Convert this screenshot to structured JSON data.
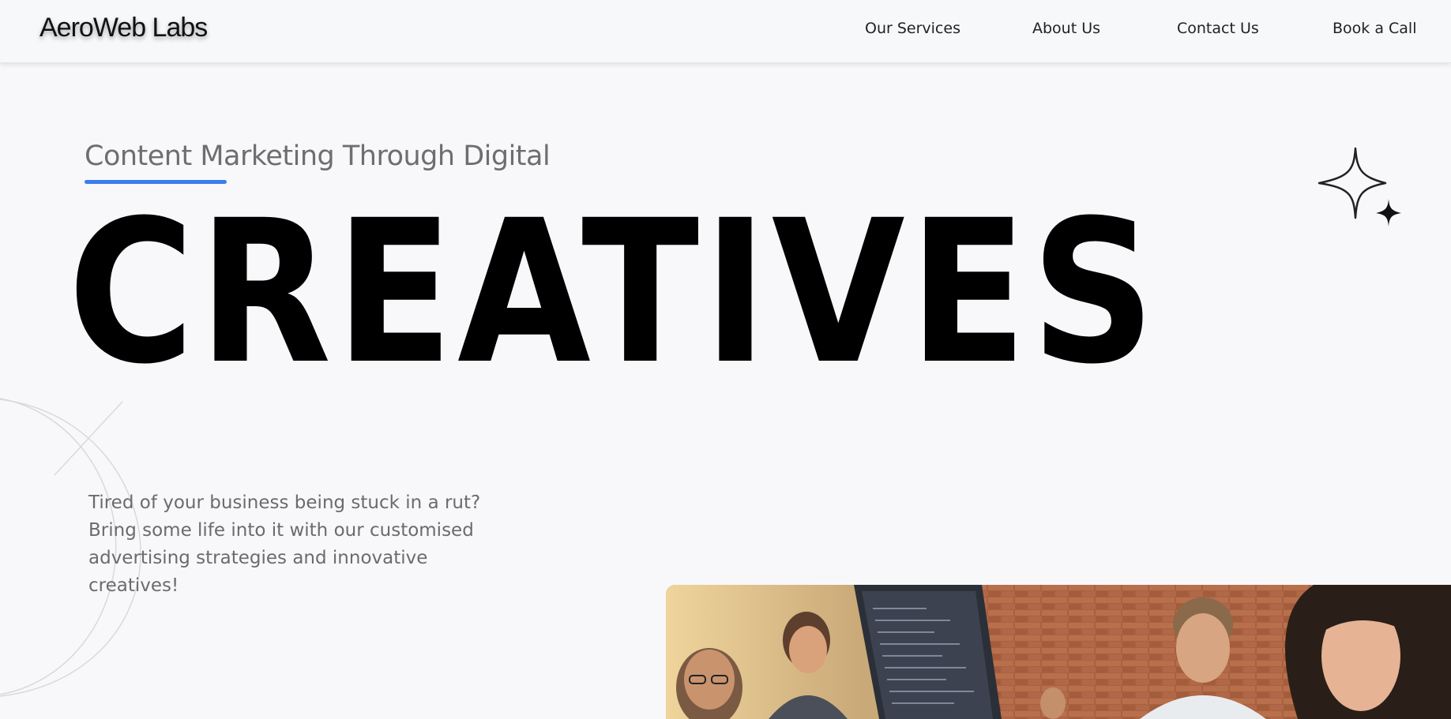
{
  "header": {
    "logo": "AeroWeb Labs",
    "nav": [
      {
        "label": "Our Services"
      },
      {
        "label": "About Us"
      },
      {
        "label": "Contact Us"
      },
      {
        "label": "Book a Call"
      }
    ]
  },
  "hero": {
    "eyebrow": "Content Marketing Through Digital",
    "title": "CREATIVES",
    "description": "Tired of your business being stuck in a rut? Bring some life into it with our customised advertising strategies and innovative creatives!",
    "accent_color": "#3b7ded",
    "icons": {
      "sparkle": "sparkle-stars-icon"
    },
    "image": "team-working-at-computers-photo"
  }
}
